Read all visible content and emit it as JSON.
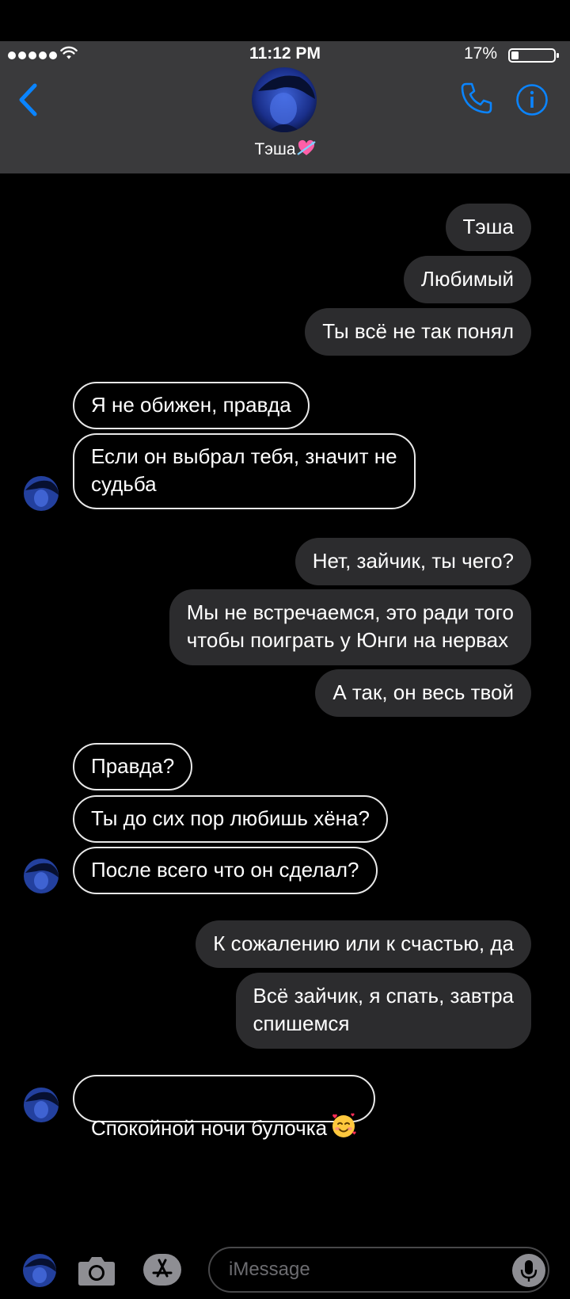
{
  "status": {
    "time": "11:12 PM",
    "battery": "17%"
  },
  "header": {
    "contact_name": "Тэша"
  },
  "messages": [
    {
      "dir": "out",
      "text": "Тэша"
    },
    {
      "dir": "out",
      "text": "Любимый"
    },
    {
      "dir": "out",
      "text": "Ты всё не так понял"
    },
    {
      "dir": "in",
      "text": "Я не обижен, правда"
    },
    {
      "dir": "in",
      "text": "Если он выбрал тебя, значит не\nсудьба"
    },
    {
      "dir": "out",
      "text": "Нет, зайчик, ты чего?"
    },
    {
      "dir": "out",
      "text": "Мы не встречаемся, это ради того\nчтобы поиграть у Юнги на нервах"
    },
    {
      "dir": "out",
      "text": "А так, он весь твой"
    },
    {
      "dir": "in",
      "text": "Правда?"
    },
    {
      "dir": "in",
      "text": "Ты до сих пор любишь хёна?"
    },
    {
      "dir": "in",
      "text": "После всего что он сделал?"
    },
    {
      "dir": "out",
      "text": "К сожалению или к счастью, да"
    },
    {
      "dir": "out",
      "text": "Всё зайчик, я спать, завтра\nспишемся"
    },
    {
      "dir": "in",
      "text": "Спокойной ночи булочка"
    }
  ],
  "composer": {
    "placeholder": "iMessage"
  },
  "colors": {
    "accent": "#0a84ff",
    "header_bg": "#3a3a3c",
    "outgoing_bubble": "#2c2c2e",
    "incoming_border": "#e8e8e8",
    "background": "#000000"
  },
  "icons": {
    "back": "chevron-left-icon",
    "call": "phone-icon",
    "info": "info-icon",
    "camera": "camera-icon",
    "apps": "app-store-icon",
    "mic": "microphone-icon",
    "name_emoji": "heart-with-arrow-icon",
    "last_message_emoji": "smiling-face-with-hearts-icon"
  }
}
